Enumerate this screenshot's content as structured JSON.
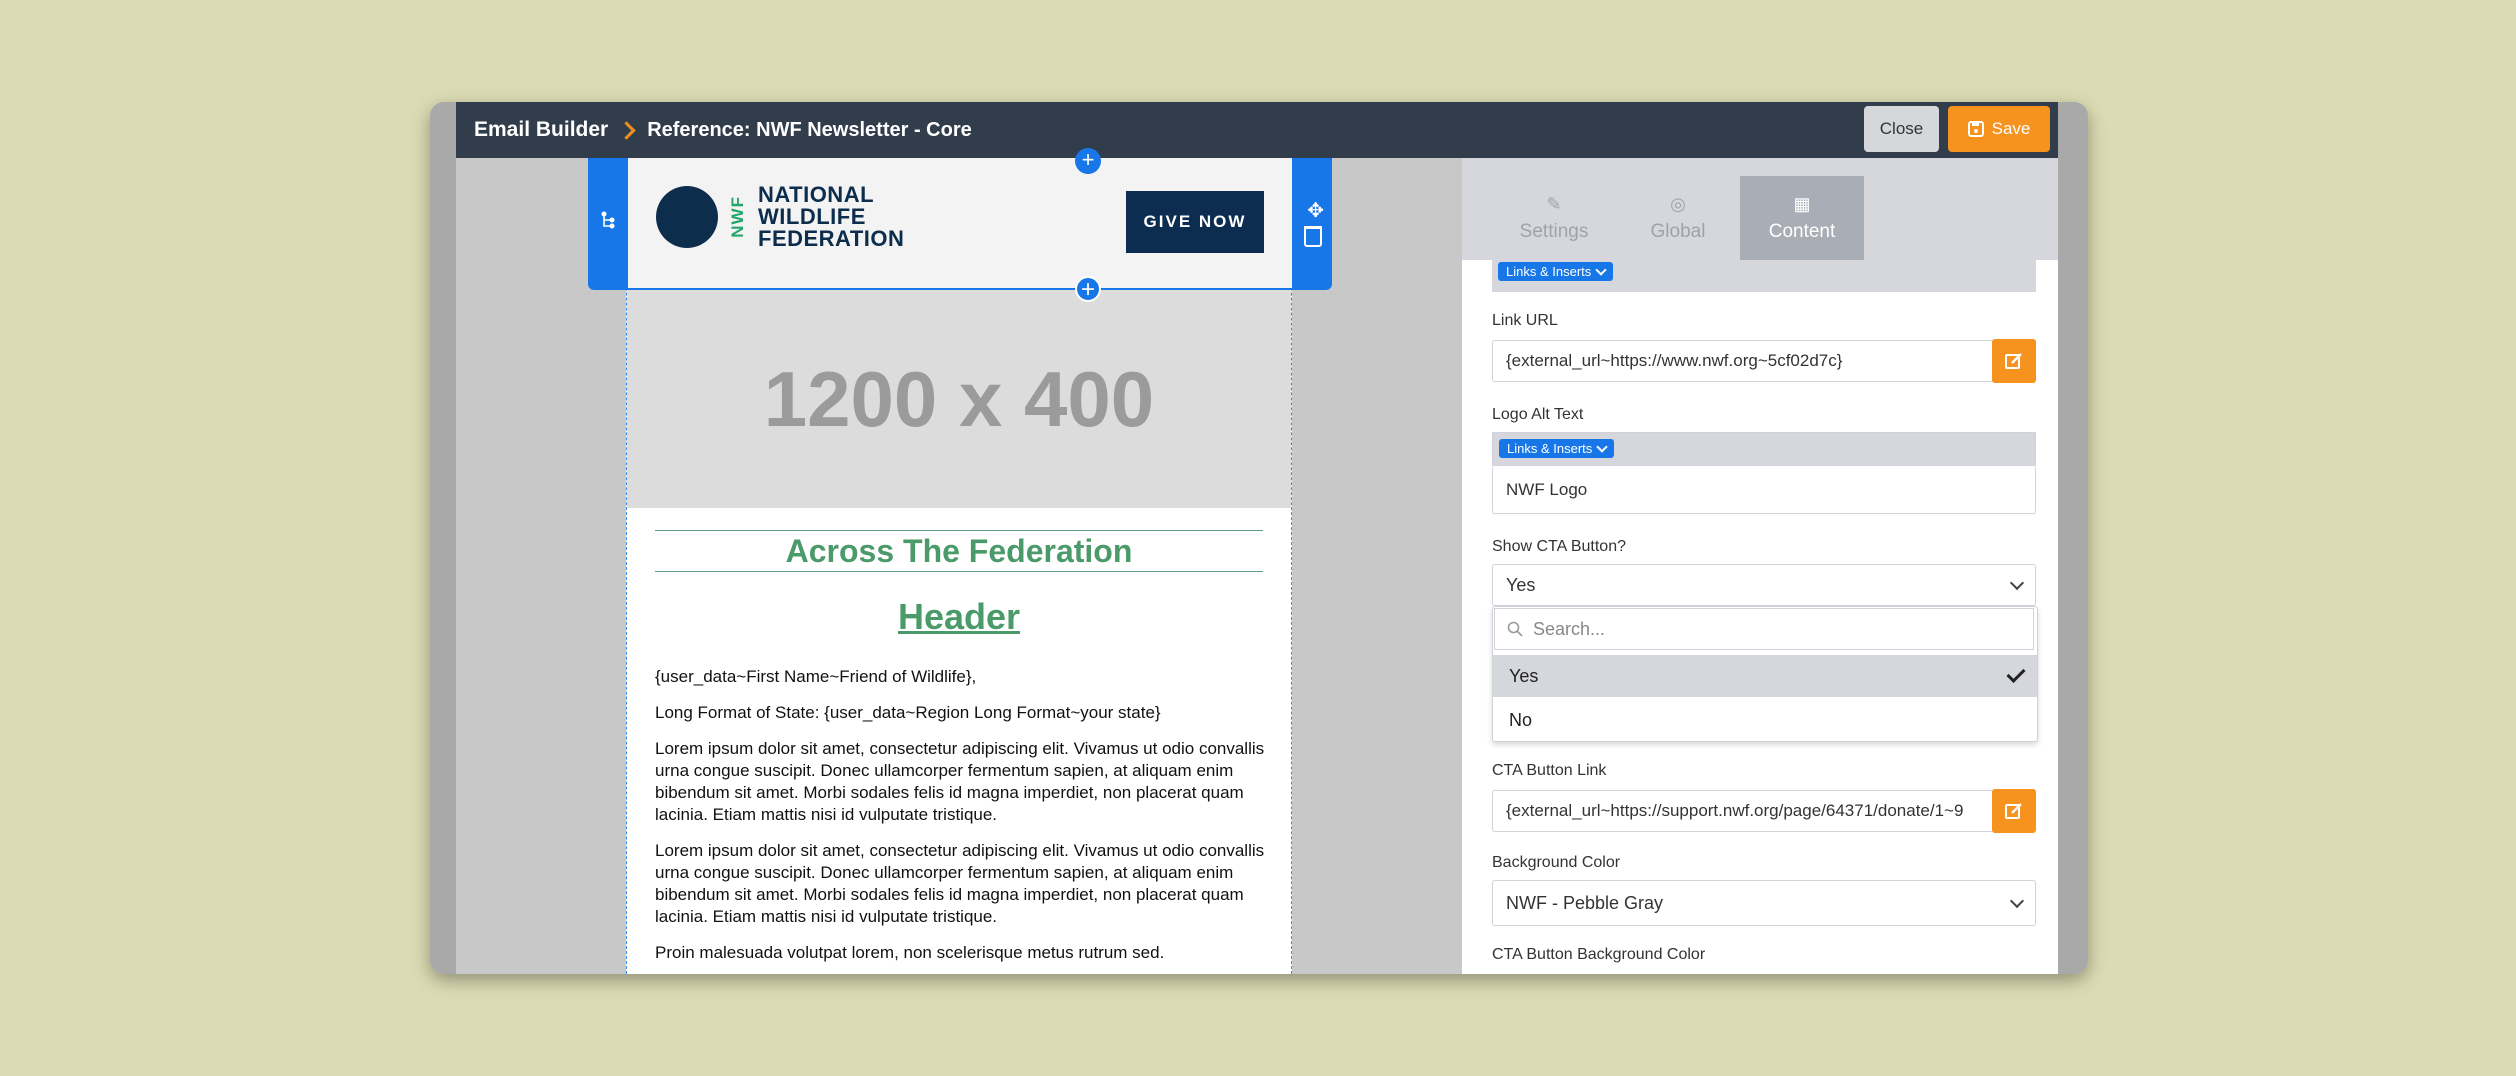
{
  "header": {
    "app_title": "Email Builder",
    "reference": "Reference: NWF Newsletter - Core",
    "close_label": "Close",
    "save_label": "Save"
  },
  "email": {
    "logo_vertical": "NWF",
    "logo_line1": "NATIONAL",
    "logo_line2": "WILDLIFE",
    "logo_line3": "FEDERATION",
    "cta_label": "GIVE NOW",
    "placeholder_image": "1200 x 400",
    "section_title": "Across The Federation",
    "header": "Header",
    "greeting": "{user_data~First Name~Friend of Wildlife},",
    "state_line": "Long Format of State: {user_data~Region Long Format~your state}",
    "paragraph1": "Lorem ipsum dolor sit amet, consectetur adipiscing elit. Vivamus ut odio convallis urna congue suscipit. Donec ullamcorper fermentum sapien, at aliquam enim bibendum sit amet. Morbi sodales felis id magna imperdiet, non placerat quam lacinia. Etiam mattis nisi id vulputate tristique.",
    "paragraph2": "Lorem ipsum dolor sit amet, consectetur adipiscing elit. Vivamus ut odio convallis urna congue suscipit. Donec ullamcorper fermentum sapien, at aliquam enim bibendum sit amet. Morbi sodales felis id magna imperdiet, non placerat quam lacinia. Etiam mattis nisi id vulputate tristique.",
    "paragraph3": "Proin malesuada volutpat lorem, non scelerisque metus rutrum sed."
  },
  "panel": {
    "tabs": [
      {
        "label": "Settings"
      },
      {
        "label": "Global"
      },
      {
        "label": "Content"
      }
    ],
    "links_inserts_label": "Links & Inserts",
    "link_url_label": "Link URL",
    "link_url_value": "{external_url~https://www.nwf.org~5cf02d7c}",
    "logo_alt_label": "Logo Alt Text",
    "logo_alt_value": "NWF Logo",
    "show_cta_label": "Show CTA Button?",
    "show_cta_value": "Yes",
    "search_placeholder": "Search...",
    "options": [
      "Yes",
      "No"
    ],
    "cta_link_label": "CTA Button Link",
    "cta_link_value": "{external_url~https://support.nwf.org/page/64371/donate/1~9",
    "bg_color_label": "Background Color",
    "bg_color_value": "NWF - Pebble Gray",
    "cta_bg_label": "CTA Button Background Color"
  }
}
